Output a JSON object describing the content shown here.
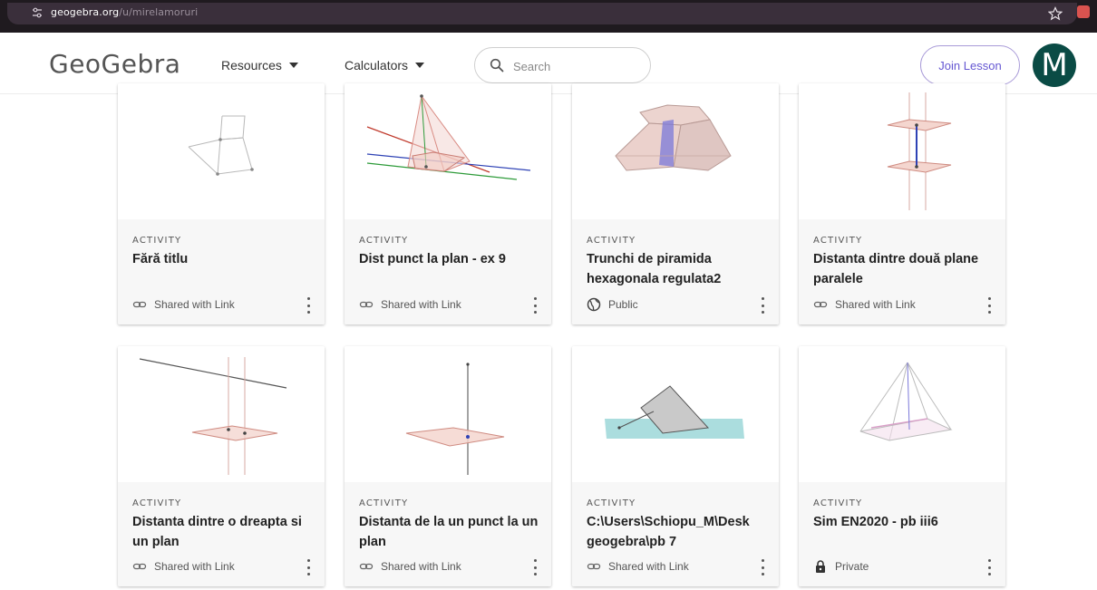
{
  "browser": {
    "url_host": "geogebra.org",
    "url_path": "/u/mirelamoruri"
  },
  "header": {
    "logo": "GeoGebra",
    "nav": [
      {
        "label": "Resources"
      },
      {
        "label": "Calculators"
      }
    ],
    "search_placeholder": "Search",
    "join_label": "Join Lesson",
    "avatar_letter": "M",
    "avatar_color": "#0a4b45",
    "accent_color": "#6557d2"
  },
  "cards": [
    {
      "type": "ACTIVITY",
      "title": "Fără titlu",
      "status": "Shared with Link",
      "status_icon": "link-icon"
    },
    {
      "type": "ACTIVITY",
      "title": "Dist punct la plan - ex 9",
      "status": "Shared with Link",
      "status_icon": "link-icon"
    },
    {
      "type": "ACTIVITY",
      "title": "Trunchi de piramida hexagonala regulata2",
      "status": "Public",
      "status_icon": "globe-icon"
    },
    {
      "type": "ACTIVITY",
      "title": "Distanta dintre două plane paralele",
      "status": "Shared with Link",
      "status_icon": "link-icon"
    },
    {
      "type": "ACTIVITY",
      "title": "Distanta dintre o dreapta si un plan",
      "status": "Shared with Link",
      "status_icon": "link-icon"
    },
    {
      "type": "ACTIVITY",
      "title": "Distanta de la un punct la un plan",
      "status": "Shared with Link",
      "status_icon": "link-icon"
    },
    {
      "type": "ACTIVITY",
      "title": "C:\\Users\\Schiopu_M\\Desk geogebra\\pb 7",
      "status": "Shared with Link",
      "status_icon": "link-icon"
    },
    {
      "type": "ACTIVITY",
      "title": "Sim EN2020 - pb iii6",
      "status": "Private",
      "status_icon": "lock-icon"
    }
  ]
}
